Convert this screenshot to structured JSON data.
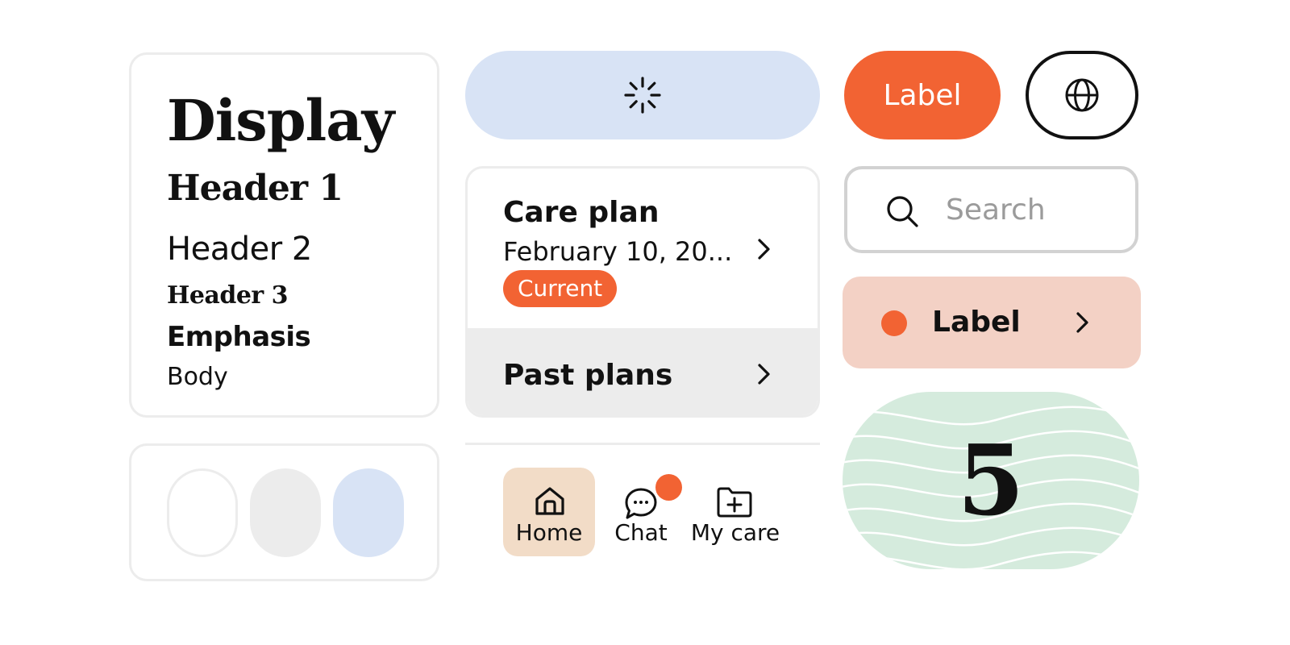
{
  "typography": {
    "display": "Display",
    "header1": "Header 1",
    "header2": "Header 2",
    "header3": "Header 3",
    "emphasis": "Emphasis",
    "body": "Body"
  },
  "swatches": [
    {
      "color": "#ffffff",
      "border": "#ececec"
    },
    {
      "color": "#ececec"
    },
    {
      "color": "#d8e3f5"
    }
  ],
  "loading_button": {
    "icon": "spinner-icon",
    "color": "#d8e3f5"
  },
  "care_plan": {
    "title": "Care plan",
    "date": "February 10, 20...",
    "status": "Current",
    "past_label": "Past plans"
  },
  "nav": {
    "items": [
      {
        "label": "Home",
        "icon": "home-icon",
        "active": true
      },
      {
        "label": "Chat",
        "icon": "chat-icon",
        "has_notification": true
      },
      {
        "label": "My care",
        "icon": "folder-plus-icon"
      }
    ]
  },
  "primary_button": {
    "label": "Label"
  },
  "globe_button": {
    "icon": "globe-icon"
  },
  "search": {
    "placeholder": "Search",
    "icon": "search-icon"
  },
  "list_item": {
    "label": "Label"
  },
  "counter": {
    "value": "5"
  },
  "colors": {
    "accent": "#f26333",
    "light_blue": "#d8e3f5",
    "light_gray": "#ececec",
    "peach": "#f3d1c5",
    "tan": "#f2dcc7",
    "mint": "#d5ebdd",
    "text": "#111111",
    "placeholder": "#9b9b9b"
  }
}
